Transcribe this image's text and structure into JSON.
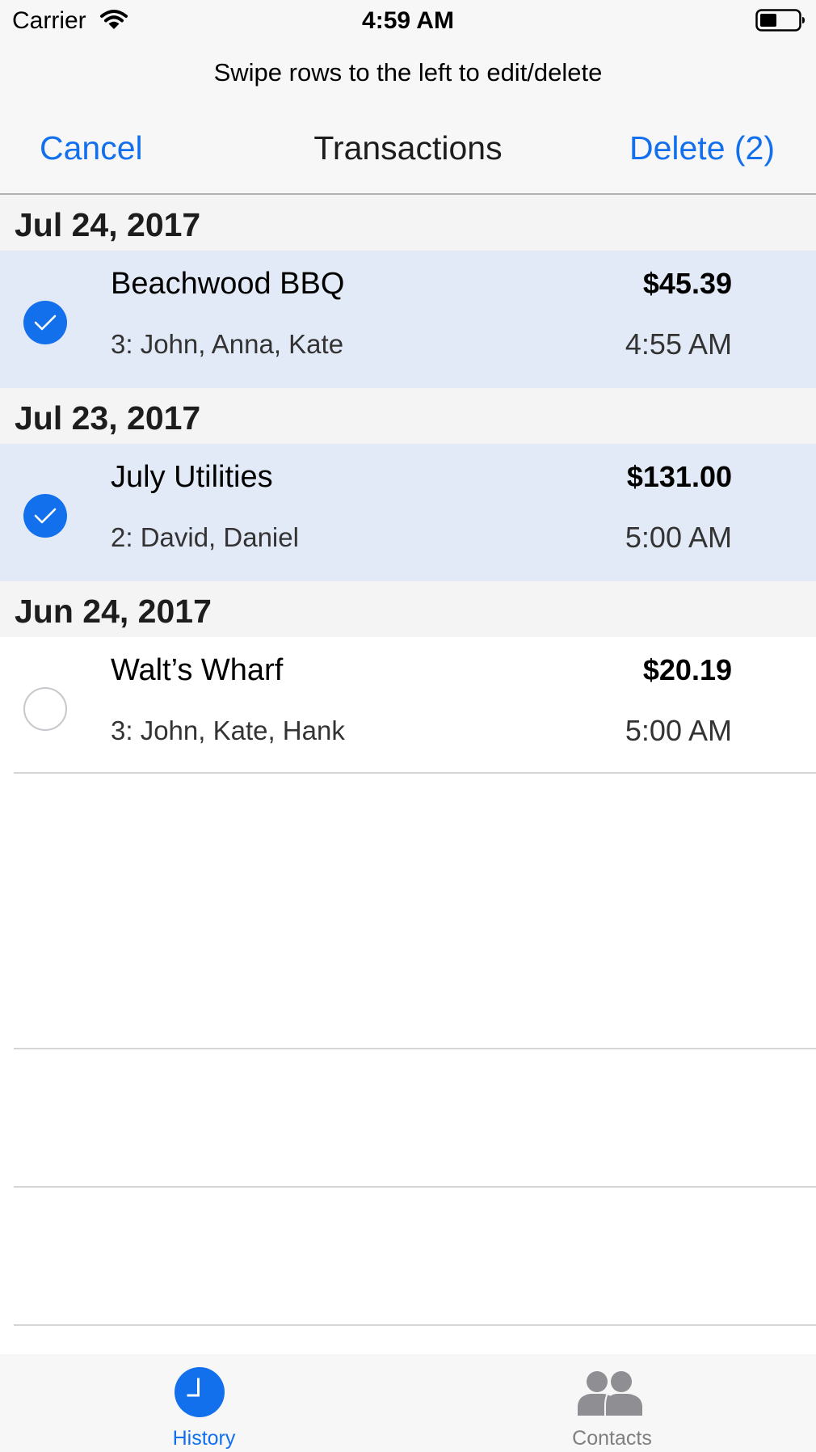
{
  "status_bar": {
    "carrier": "Carrier",
    "time": "4:59 AM"
  },
  "nav": {
    "prompt": "Swipe rows to the left to edit/delete",
    "cancel_label": "Cancel",
    "title": "Transactions",
    "delete_label": "Delete (2)"
  },
  "sections": [
    {
      "date": "Jul 24, 2017",
      "rows": [
        {
          "name": "Beachwood BBQ",
          "amount": "$45.39",
          "people": "3: John, Anna, Kate",
          "time": "4:55 AM",
          "selected": true
        }
      ]
    },
    {
      "date": "Jul 23, 2017",
      "rows": [
        {
          "name": "July Utilities",
          "amount": "$131.00",
          "people": "2: David, Daniel",
          "time": "5:00 AM",
          "selected": true
        }
      ]
    },
    {
      "date": "Jun 24, 2017",
      "rows": [
        {
          "name": "Walt’s Wharf",
          "amount": "$20.19",
          "people": "3: John, Kate, Hank",
          "time": "5:00 AM",
          "selected": false
        }
      ]
    }
  ],
  "tab_bar": {
    "tabs": [
      {
        "label": "History",
        "icon": "clock-icon",
        "active": true
      },
      {
        "label": "Contacts",
        "icon": "contacts-icon",
        "active": false
      }
    ]
  },
  "colors": {
    "accent": "#1370ec",
    "selected_row": "#e3eaf7",
    "section_header": "#f4f4f4",
    "bar_background": "#f7f7f7",
    "inactive_tab": "#7f7f7f"
  }
}
